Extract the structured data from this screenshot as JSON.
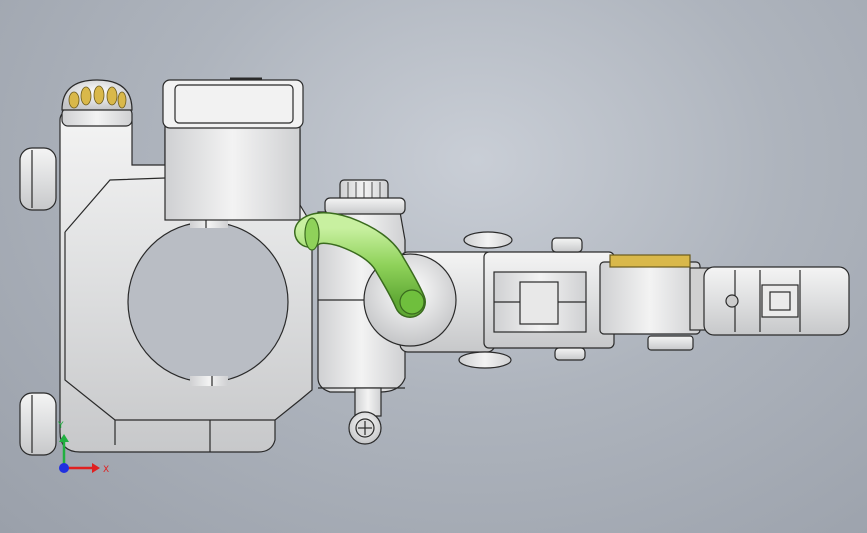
{
  "viewport": {
    "background_top": "#c9ced6",
    "background_bottom": "#9aa0aa"
  },
  "model": {
    "body_color": "#e4e5e6",
    "edge_color": "#2a2a2a",
    "hose_color": "#8fd25a",
    "brass_color": "#d9b84a"
  },
  "triad": {
    "x_label": "X",
    "y_label": "Y",
    "x_color": "#e02020",
    "y_color": "#20b040",
    "z_color": "#2030e0"
  }
}
